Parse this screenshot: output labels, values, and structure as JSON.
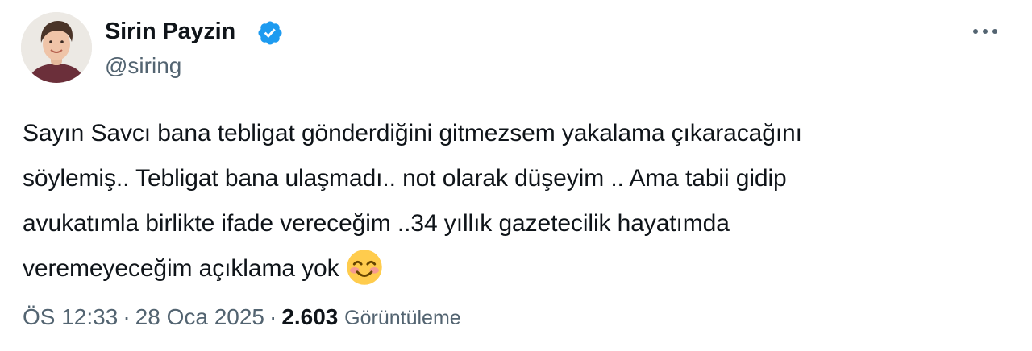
{
  "author": {
    "display_name": "Sirin Payzin",
    "handle": "@siring",
    "verified": true,
    "avatar": "profile-photo",
    "verified_color": "#1d9bf0"
  },
  "menu": {
    "icon": "more-horizontal-icon"
  },
  "tweet": {
    "lines": [
      "Sayın Savcı bana tebligat gönderdiğini gitmezsem yakalama çıkaracağını",
      "söylemiş.. Tebligat bana ulaşmadı.. not olarak düşeyim .. Ama tabii gidip",
      "avukatımla birlikte ifade vereceğim ..34 yıllık gazetecilik hayatımda",
      "veremeyeceğim açıklama yok"
    ],
    "emoji": "smiling-face-with-smiling-eyes"
  },
  "meta": {
    "time": "ÖS 12:33",
    "separator": "·",
    "date": "28 Oca 2025",
    "views_count": "2.603",
    "views_label": "Görüntüleme"
  },
  "colors": {
    "text": "#0f1419",
    "secondary": "#536471",
    "accent": "#1d9bf0"
  }
}
